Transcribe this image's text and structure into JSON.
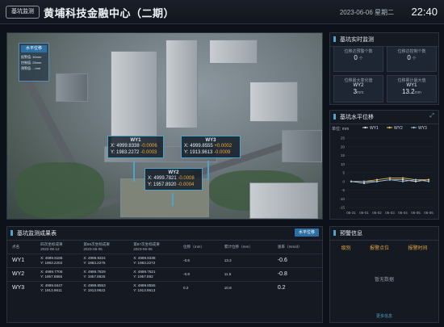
{
  "header": {
    "badge": "基坑监测",
    "title": "黄埔科技金融中心（二期）",
    "date": "2023-06-06 星期二",
    "time": "22:40"
  },
  "map": {
    "legend_title": "水平位移",
    "legend_lines": [
      "报警值: 30mm",
      "控制值: 25mm",
      "预警值: ...mm"
    ],
    "markers": [
      {
        "name": "WY1",
        "x_label": "X: 4999.8338",
        "x_delta": "-0.0006",
        "y_label": "Y: 1983.2272",
        "y_delta": "-0.0003"
      },
      {
        "name": "WY3",
        "x_label": "X: 4999.8555",
        "x_delta": "+0.0002",
        "y_label": "Y: 1913.9613",
        "y_delta": "-0.0009"
      },
      {
        "name": "WY2",
        "x_label": "X: 4999.7821",
        "x_delta": "-0.0008",
        "y_label": "Y: 1957.8920",
        "y_delta": "-0.0004"
      }
    ]
  },
  "realtime": {
    "title": "基坑实时监测",
    "cells": [
      {
        "label": "位移达预警个数",
        "value": "0",
        "unit": "个"
      },
      {
        "label": "位移达控制个数",
        "value": "0",
        "unit": "个"
      },
      {
        "label": "位移最大变化值",
        "value": "WY2",
        "sub": "3",
        "unit": "mm"
      },
      {
        "label": "位移累计最大值",
        "value": "WY1",
        "sub": "13.2",
        "unit": "mm"
      }
    ]
  },
  "chart_panel": {
    "title": "基坑水平位移",
    "ylabel": "单位: mm"
  },
  "chart_data": {
    "type": "line",
    "title": "基坑水平位移",
    "ylabel": "单位: mm",
    "xlabel": "",
    "categories": [
      "05-31",
      "06-01",
      "06-02",
      "06-03",
      "06-04",
      "06-05",
      "06-06"
    ],
    "ylim": [
      -15,
      25
    ],
    "yticks": [
      25,
      20,
      15,
      10,
      5,
      0,
      -5,
      -10,
      -15
    ],
    "legend": "top-right",
    "series": [
      {
        "name": "WY1",
        "color": "#d8dde4",
        "values": [
          0,
          -1,
          0,
          1,
          1,
          0,
          1
        ]
      },
      {
        "name": "WY2",
        "color": "#e8c45a",
        "values": [
          0,
          0,
          1,
          2,
          2,
          1,
          1
        ]
      },
      {
        "name": "WY3",
        "color": "#9ab8d6",
        "values": [
          0,
          0,
          0,
          1,
          0,
          1,
          0
        ]
      }
    ]
  },
  "table": {
    "title": "基坑监测成果表",
    "tab_label": "水平位移",
    "headers": [
      "点名",
      "四次坐标成果\n2022-08-12",
      "第86次坐标成果\n2023-06-05",
      "第87次坐标成果\n2023-06-06",
      "位移（mm）",
      "累计位移（mm）",
      "速率（mm/d）"
    ],
    "rows": [
      {
        "name": "WY1",
        "c1": [
          "X: 4999.8186",
          "Y: 1983.2202"
        ],
        "c2": [
          "X: 4999.8324",
          "Y: 1983.2275"
        ],
        "c3": [
          "X: 4999.8338",
          "Y: 1983.2272"
        ],
        "disp": "-0.6",
        "cum": "13.2",
        "rate": "-0.6"
      },
      {
        "name": "WY2",
        "c1": [
          "X: 4999.7706",
          "Y: 1957.8865"
        ],
        "c2": [
          "X: 4999.7829",
          "Y: 1957.8925"
        ],
        "c3": [
          "X: 4999.7821",
          "Y: 1957.892"
        ],
        "disp": "-0.8",
        "cum": "11.5",
        "rate": "-0.8"
      },
      {
        "name": "WY3",
        "c1": [
          "X: 4999.8447",
          "Y: 1913.9611"
        ],
        "c2": [
          "X: 4999.8553",
          "Y: 1913.9622"
        ],
        "c3": [
          "X: 4999.8555",
          "Y: 1913.9613"
        ],
        "disp": "0.2",
        "cum": "10.8",
        "rate": "0.2"
      }
    ]
  },
  "warning": {
    "title": "预警信息",
    "headers": [
      "级别",
      "报警点位",
      "报警时间"
    ],
    "empty_text": "暂无数据",
    "more_label": "更多信息"
  }
}
